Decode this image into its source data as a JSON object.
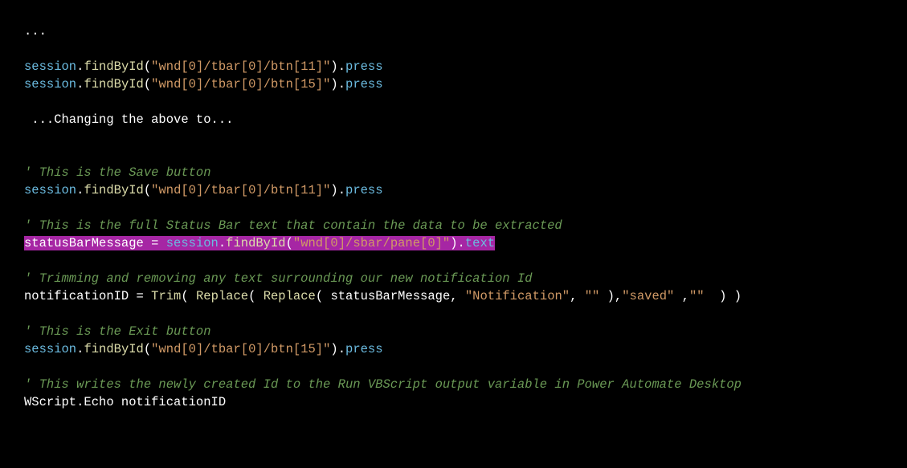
{
  "lines": {
    "l1_ellipsis": "...",
    "l3_obj": "session",
    "l3_meth": "findById",
    "l3_str": "\"wnd[0]/tbar[0]/btn[11]\"",
    "l3_prop": "press",
    "l4_obj": "session",
    "l4_meth": "findById",
    "l4_str": "\"wnd[0]/tbar[0]/btn[15]\"",
    "l4_prop": "press",
    "l6_text": " ...Changing the above to...",
    "l9_comment": "' This is the Save button",
    "l10_obj": "session",
    "l10_meth": "findById",
    "l10_str": "\"wnd[0]/tbar[0]/btn[11]\"",
    "l10_prop": "press",
    "l12_comment": "' This is the full Status Bar text that contain the data to be extracted",
    "l13_var": "statusBarMessage",
    "l13_eq": " = ",
    "l13_obj": "session",
    "l13_meth": "findById",
    "l13_str": "\"wnd[0]/sbar/pane[0]\"",
    "l13_prop": "text",
    "l15_comment": "' Trimming and removing any text surrounding our new notification Id",
    "l16_var": "notificationID",
    "l16_eq": " = ",
    "l16_trim": "Trim",
    "l16_rep1": "Replace",
    "l16_rep2": "Replace",
    "l16_arg_var": "statusBarMessage",
    "l16_s1": "\"Notification\"",
    "l16_s2": "\"\"",
    "l16_s3": "\"saved\"",
    "l16_s4": "\"\"",
    "l18_comment": "' This is the Exit button",
    "l19_obj": "session",
    "l19_meth": "findById",
    "l19_str": "\"wnd[0]/tbar[0]/btn[15]\"",
    "l19_prop": "press",
    "l21_comment": "' This writes the newly created Id to the Run VBScript output variable in Power Automate Desktop",
    "l22_text": "WScript.Echo notificationID"
  }
}
